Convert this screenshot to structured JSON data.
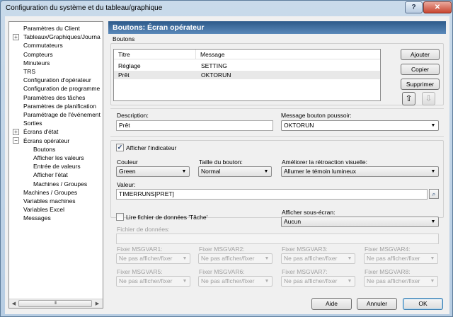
{
  "window": {
    "title": "Configuration du système et du tableau/graphique",
    "help_label": "?",
    "close_label": "✕"
  },
  "tree": {
    "items": [
      {
        "label": "Paramètres du Client",
        "expander": ""
      },
      {
        "label": "Tableaux/Graphiques/Journa",
        "expander": "+"
      },
      {
        "label": "Commutateurs",
        "expander": ""
      },
      {
        "label": "Compteurs",
        "expander": ""
      },
      {
        "label": "Minuteurs",
        "expander": ""
      },
      {
        "label": "TRS",
        "expander": ""
      },
      {
        "label": "Configuration d'opérateur",
        "expander": ""
      },
      {
        "label": "Configuration de programme",
        "expander": ""
      },
      {
        "label": "Paramètres des tâches",
        "expander": ""
      },
      {
        "label": "Paramètres de planification",
        "expander": ""
      },
      {
        "label": "Paramétrage de l'événement",
        "expander": ""
      },
      {
        "label": "Sorties",
        "expander": ""
      },
      {
        "label": "Écrans d'état",
        "expander": "+"
      },
      {
        "label": "Écrans opérateur",
        "expander": "−"
      },
      {
        "label": "Boutons",
        "expander": ""
      },
      {
        "label": "Afficher les valeurs",
        "expander": ""
      },
      {
        "label": "Entrée de valeurs",
        "expander": ""
      },
      {
        "label": "Afficher l'état",
        "expander": ""
      },
      {
        "label": "Machines / Groupes",
        "expander": ""
      },
      {
        "label": "Machines / Groupes",
        "expander": ""
      },
      {
        "label": "Variables machines",
        "expander": ""
      },
      {
        "label": "Variables Excel",
        "expander": ""
      },
      {
        "label": "Messages",
        "expander": ""
      }
    ],
    "scroll_thumb_grip": "III"
  },
  "panel": {
    "header": "Boutons: Écran opérateur",
    "buttons_group_label": "Boutons",
    "list": {
      "columns": [
        "Titre",
        "Message"
      ],
      "rows": [
        {
          "title": "Réglage",
          "message": "SETTING"
        },
        {
          "title": "Prêt",
          "message": "OKTORUN"
        }
      ]
    },
    "actions": {
      "add": "Ajouter",
      "copy": "Copier",
      "delete": "Supprimer",
      "up": "⇧",
      "down": "⇩"
    },
    "description": {
      "label": "Description:",
      "value": "Prêt"
    },
    "push_message": {
      "label": "Message bouton poussoir:",
      "value": "OKTORUN"
    },
    "show_indicator": {
      "label": "Afficher l'indicateur",
      "checked": true,
      "mark": "✓"
    },
    "color": {
      "label": "Couleur",
      "value": "Green"
    },
    "button_size": {
      "label": "Taille du bouton:",
      "value": "Normal"
    },
    "visual_feedback": {
      "label": "Améliorer la rétroaction visuelle:",
      "value": "Allumer le témoin lumineux"
    },
    "value": {
      "label": "Valeur:",
      "value": "TIMERRUNS[PRET]"
    },
    "read_task_file": {
      "label": "Lire fichier de données 'Tâche'",
      "checked": false
    },
    "sub_screen": {
      "label": "Afficher sous-écran:",
      "value": "Aucun"
    },
    "data_file": {
      "label": "Fichier de données:",
      "value": ""
    },
    "msgvars": [
      {
        "label": "Fixer MSGVAR1:",
        "value": "Ne pas afficher/fixer"
      },
      {
        "label": "Fixer MSGVAR2:",
        "value": "Ne pas afficher/fixer"
      },
      {
        "label": "Fixer MSGVAR3:",
        "value": "Ne pas afficher/fixer"
      },
      {
        "label": "Fixer MSGVAR4:",
        "value": "Ne pas afficher/fixer"
      },
      {
        "label": "Fixer MSGVAR5:",
        "value": "Ne pas afficher/fixer"
      },
      {
        "label": "Fixer MSGVAR6:",
        "value": "Ne pas afficher/fixer"
      },
      {
        "label": "Fixer MSGVAR7:",
        "value": "Ne pas afficher/fixer"
      },
      {
        "label": "Fixer MSGVAR8:",
        "value": "Ne pas afficher/fixer"
      }
    ]
  },
  "footer": {
    "help": "Aide",
    "cancel": "Annuler",
    "ok": "OK"
  },
  "icons": {
    "search": "⌕",
    "caret": "▼",
    "left_arrow": "◀",
    "right_arrow": "▶"
  },
  "colors": {
    "header_bg": "#3a6898",
    "selected_row": "#e8e8e8",
    "close_button": "#c9452f"
  }
}
